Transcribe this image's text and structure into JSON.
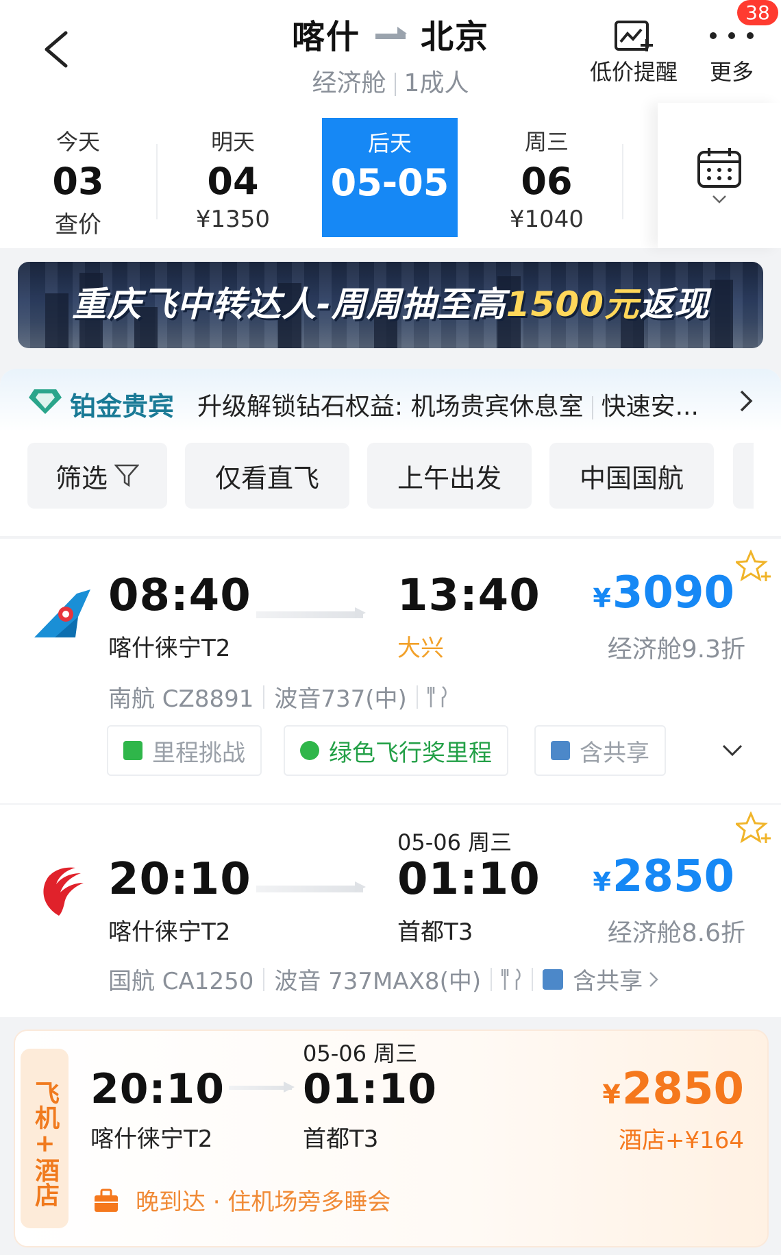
{
  "header": {
    "origin": "喀什",
    "destination": "北京",
    "cabin": "经济舱",
    "passengers": "1成人",
    "price_alert_label": "低价提醒",
    "more_label": "更多",
    "notification_count": "38"
  },
  "dates": [
    {
      "label": "今天",
      "day": "03",
      "price": "查价",
      "active": false
    },
    {
      "label": "明天",
      "day": "04",
      "price": "¥1350",
      "active": false
    },
    {
      "label": "后天",
      "day": "05-05",
      "price": "",
      "active": true
    },
    {
      "label": "周三",
      "day": "06",
      "price": "¥1040",
      "active": false
    }
  ],
  "banner": {
    "text_main": "重庆飞中转达人-周周抽至高",
    "text_highlight": "1500元",
    "text_tail": "返现"
  },
  "member": {
    "tier": "铂金贵宾",
    "description": "升级解锁钻石权益: 机场贵宾休息室",
    "description_tail": "快速安..."
  },
  "filters": [
    "筛选",
    "仅看直飞",
    "上午出发",
    "中国国航"
  ],
  "flights": [
    {
      "dep_time": "08:40",
      "dep_airport": "喀什徕宁T2",
      "arr_time": "13:40",
      "arr_airport": "大兴",
      "arr_date": "",
      "price_currency": "¥",
      "price": "3090",
      "cabin_discount": "经济舱9.3折",
      "airline_flight": "南航 CZ8891",
      "aircraft": "波音737(中)",
      "tags": [
        "里程挑战",
        "绿色飞行奖里程",
        "含共享"
      ]
    },
    {
      "dep_time": "20:10",
      "dep_airport": "喀什徕宁T2",
      "arr_time": "01:10",
      "arr_airport": "首都T3",
      "arr_date": "05-06 周三",
      "price_currency": "¥",
      "price": "2850",
      "cabin_discount": "经济舱8.6折",
      "airline_flight": "国航 CA1250",
      "aircraft": "波音 737MAX8(中)",
      "share_label": "含共享"
    }
  ],
  "combo": {
    "side_label": "飞机+酒店",
    "dep_time": "20:10",
    "dep_airport": "喀什徕宁T2",
    "arr_time": "01:10",
    "arr_airport": "首都T3",
    "arr_date": "05-06 周三",
    "price_currency": "¥",
    "price": "2850",
    "hotel_extra": "酒店+¥164",
    "note": "晚到达 · 住机场旁多睡会"
  },
  "colors": {
    "accent_blue": "#1688f5",
    "orange": "#f5781d",
    "member_teal": "#1a7a96"
  }
}
